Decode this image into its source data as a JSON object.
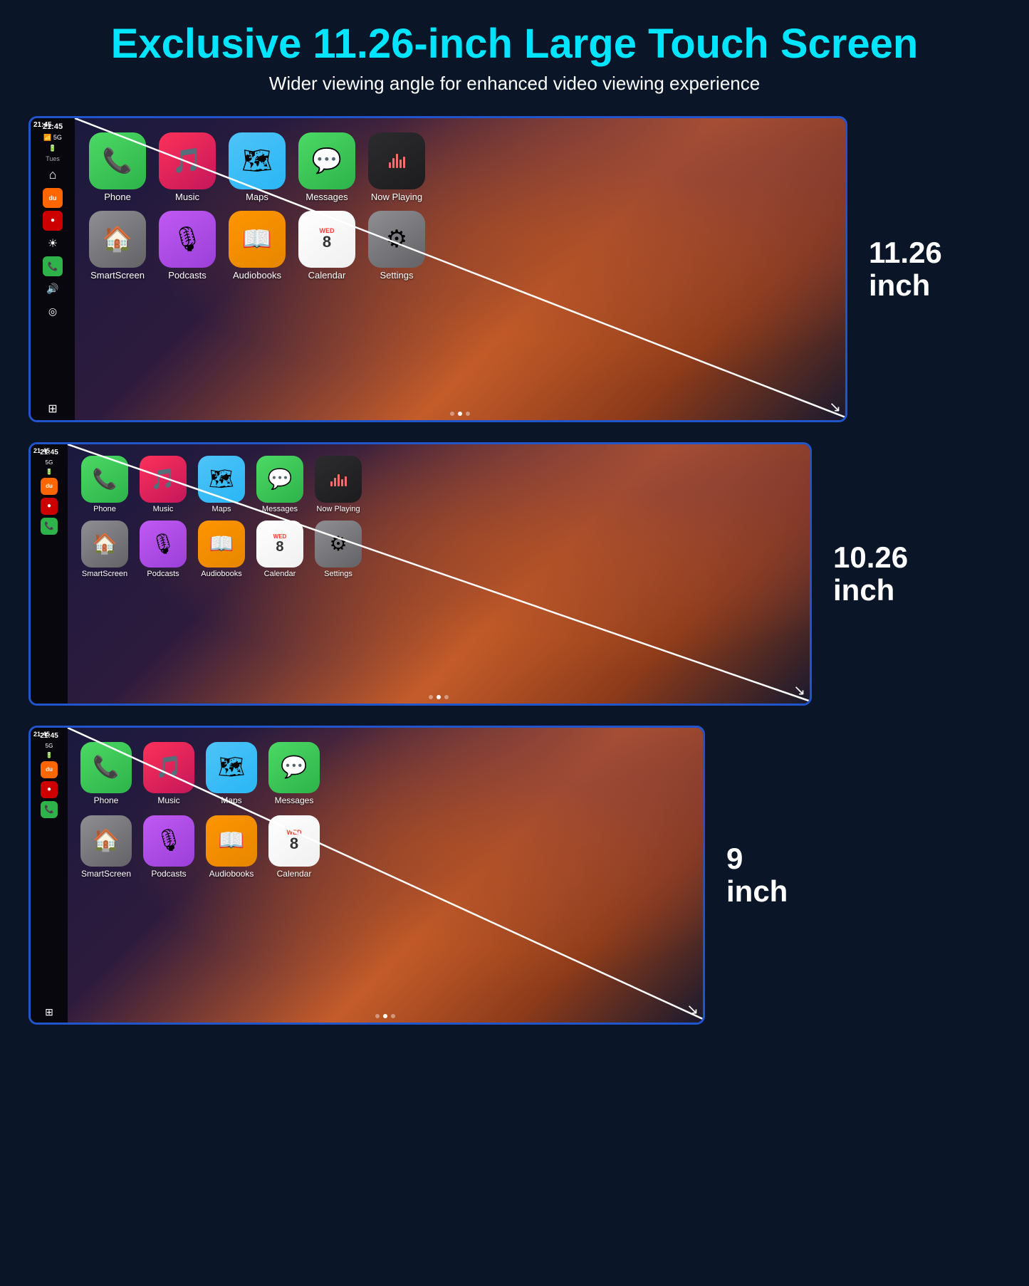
{
  "header": {
    "title": "Exclusive 11.26-inch Large Touch Screen",
    "subtitle": "Wider viewing angle for enhanced video viewing experience"
  },
  "screens": [
    {
      "id": "screen1",
      "size_label": "11.26",
      "size_unit": "inch",
      "time": "21:45",
      "signal": "5G",
      "battery": "▪",
      "day": "Tues",
      "apps_row1": [
        {
          "id": "phone",
          "label": "Phone",
          "icon": "phone"
        },
        {
          "id": "music",
          "label": "Music",
          "icon": "music"
        },
        {
          "id": "maps",
          "label": "Maps",
          "icon": "maps"
        },
        {
          "id": "messages",
          "label": "Messages",
          "icon": "messages"
        },
        {
          "id": "nowplaying",
          "label": "Now Playing",
          "icon": "nowplaying"
        }
      ],
      "apps_row2": [
        {
          "id": "smartscreen",
          "label": "SmartScreen",
          "icon": "smartscreen"
        },
        {
          "id": "podcasts",
          "label": "Podcasts",
          "icon": "podcasts"
        },
        {
          "id": "audiobooks",
          "label": "Audiobooks",
          "icon": "audiobooks"
        },
        {
          "id": "calendar",
          "label": "Calendar",
          "icon": "calendar"
        },
        {
          "id": "settings",
          "label": "Settings",
          "icon": "settings"
        }
      ],
      "dots": [
        false,
        true,
        false
      ]
    },
    {
      "id": "screen2",
      "size_label": "10.26",
      "size_unit": "inch",
      "time": "21:45",
      "signal": "5G",
      "apps_row1": [
        {
          "id": "phone",
          "label": "Phone",
          "icon": "phone"
        },
        {
          "id": "music",
          "label": "Music",
          "icon": "music"
        },
        {
          "id": "maps",
          "label": "Maps",
          "icon": "maps"
        },
        {
          "id": "messages",
          "label": "Messages",
          "icon": "messages"
        },
        {
          "id": "nowplaying",
          "label": "Now Playing",
          "icon": "nowplaying"
        }
      ],
      "apps_row2": [
        {
          "id": "smartscreen",
          "label": "SmartScreen",
          "icon": "smartscreen"
        },
        {
          "id": "podcasts",
          "label": "Podcasts",
          "icon": "podcasts"
        },
        {
          "id": "audiobooks",
          "label": "Audiobooks",
          "icon": "audiobooks"
        },
        {
          "id": "calendar",
          "label": "Calendar",
          "icon": "calendar"
        },
        {
          "id": "settings",
          "label": "Settings",
          "icon": "settings"
        }
      ],
      "dots": [
        false,
        true,
        false
      ]
    },
    {
      "id": "screen3",
      "size_label": "9",
      "size_unit": "inch",
      "time": "21:45",
      "signal": "5G",
      "apps_row1": [
        {
          "id": "phone",
          "label": "Phone",
          "icon": "phone"
        },
        {
          "id": "music",
          "label": "Music",
          "icon": "music"
        },
        {
          "id": "maps",
          "label": "Maps",
          "icon": "maps"
        },
        {
          "id": "messages",
          "label": "Messages",
          "icon": "messages"
        }
      ],
      "apps_row2": [
        {
          "id": "smartscreen",
          "label": "SmartScreen",
          "icon": "smartscreen"
        },
        {
          "id": "podcasts",
          "label": "Podcasts",
          "icon": "podcasts"
        },
        {
          "id": "audiobooks",
          "label": "Audiobooks",
          "icon": "audiobooks"
        },
        {
          "id": "calendar",
          "label": "Calendar",
          "icon": "calendar"
        }
      ],
      "dots": [
        false,
        true,
        false
      ]
    }
  ],
  "icons": {
    "home": "⌂",
    "brightness": "☀",
    "volume": "🔊",
    "camera": "◎",
    "grid": "⊞"
  }
}
